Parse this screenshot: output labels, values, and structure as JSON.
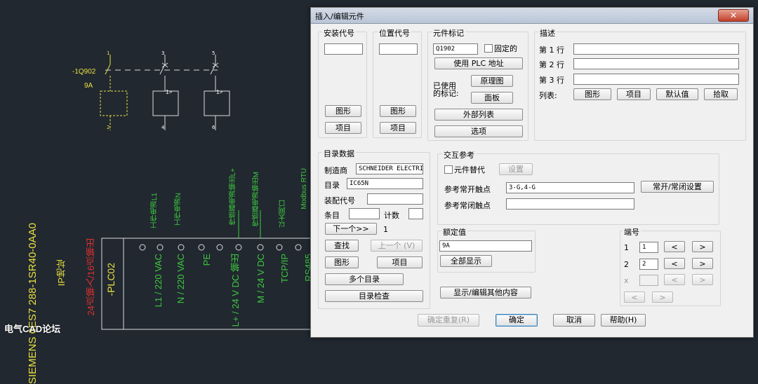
{
  "cad": {
    "tag_left": "-1Q902",
    "rating_left": "9A",
    "num_top": [
      "1",
      "3",
      "5"
    ],
    "num_bottom": [
      "2",
      "4",
      "6"
    ],
    "vertical_labels": [
      "工作电源L1",
      "工作电源N",
      "传感器电源输出L+",
      "传感器电源输出M",
      "以太网口",
      "Modbus RTU"
    ],
    "terminal_labels": [
      "L1 / 220 VAC",
      "N / 220 VAC",
      "PE",
      "L+ / 24 V DC 输出",
      "M / 24 V DC",
      "TCP/IP",
      "RS485"
    ],
    "plc_tag": "-PLC02",
    "plc_desc_red": "24点输入/16点输出",
    "plc_desc_yellow": "IP地址",
    "plc_desc_green": "SIEMENS 6ES7 288-1SR40-0AA0",
    "watermark": "电气CAD论坛"
  },
  "dialog": {
    "title": "插入/编辑元件",
    "close": "✕",
    "install": {
      "label": "安装代号",
      "value": "",
      "btn_graphic": "图形",
      "btn_item": "项目"
    },
    "location": {
      "label": "位置代号",
      "value": "",
      "btn_graphic": "图形",
      "btn_item": "项目"
    },
    "tag": {
      "label": "元件标记",
      "value": "Q1902",
      "fixed_label": "固定的",
      "btn_plc": "使用 PLC 地址",
      "used_label_1": "已使用",
      "used_label_2": "的标记:",
      "btn_schematic": "原理图",
      "btn_panel": "面板",
      "btn_ext_list": "外部列表",
      "btn_options": "选项"
    },
    "desc": {
      "label": "描述",
      "line1_label": "第 1 行",
      "line2_label": "第 2 行",
      "line3_label": "第 3 行",
      "line1": "",
      "line2": "",
      "line3": "",
      "list_label": "列表:",
      "btn_graphic": "图形",
      "btn_item": "项目",
      "btn_default": "默认值",
      "btn_pick": "拾取"
    },
    "catalog": {
      "label": "目录数据",
      "mfr_label": "制造商",
      "mfr": "SCHNEIDER ELECTRI",
      "cat_label": "目录",
      "cat": "IC65N",
      "assy_label": "装配代号",
      "assy": "",
      "item_label": "条目",
      "item": "",
      "count_label": "计数",
      "count": "",
      "btn_next": "下一个>>",
      "next_num": "1",
      "btn_find": "查找",
      "btn_prev": "上一个 (V)",
      "btn_graphic": "图形",
      "btn_item": "项目",
      "btn_multi": "多个目录",
      "btn_check": "目录检查"
    },
    "xref": {
      "label": "交互参考",
      "comp_override": "元件替代",
      "btn_setup": "设置",
      "no_label": "参考常开触点",
      "no_value": "3-G,4-G",
      "btn_nonc": "常开/常闭设置",
      "nc_label": "参考常闭触点",
      "nc_value": ""
    },
    "rating": {
      "label": "额定值",
      "value": "9A",
      "btn_show_all": "全部显示"
    },
    "btn_show_edit": "显示/编辑其他内容",
    "pins": {
      "label": "端号",
      "row1_label": "1",
      "row1_value": "1",
      "row2_label": "2",
      "row2_value": "2",
      "row3_label": "x",
      "lt": "<",
      "gt": ">"
    },
    "footer": {
      "btn_ok_repeat": "确定重复(R)",
      "btn_ok": "确定",
      "btn_cancel": "取消",
      "btn_help": "帮助(H)"
    }
  }
}
